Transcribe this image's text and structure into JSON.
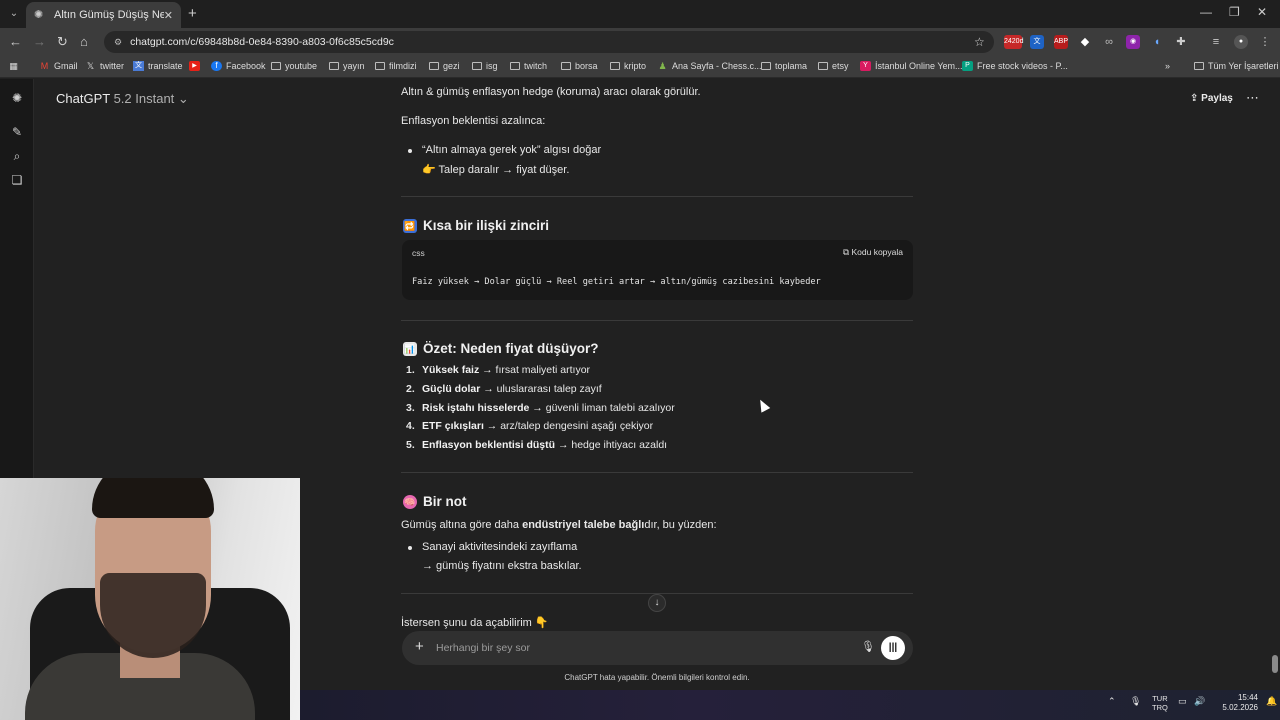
{
  "browser": {
    "tab_title": "Altın Gümüş Düşüş Nedenleri",
    "url": "chatgpt.com/c/69848b8d-0e84-8390-a803-0f6c85c5cd9c",
    "ext_badge": "2420d",
    "bookmarks": [
      "Gmail",
      "twitter",
      "translate",
      "Facebook",
      "youtube",
      "yayın",
      "filmdizi",
      "gezi",
      "isg",
      "twitch",
      "borsa",
      "kripto",
      "Ana Sayfa - Chess.c...",
      "toplama",
      "etsy",
      "İstanbul Online Yem...",
      "Free stock videos - P..."
    ],
    "all_bookmarks": "Tüm Yer İşaretleri"
  },
  "header": {
    "model_name": "ChatGPT",
    "model_version": "5.2 Instant",
    "share_label": "Paylaş"
  },
  "message": {
    "p1": "Altın & gümüş enflasyon hedge (koruma) aracı olarak görülür.",
    "p2": "Enflasyon beklentisi azalınca:",
    "bullet1_line1": "“Altın almaya gerek yok” algısı doğar",
    "bullet1_line2": "👉 Talep daralır → fiyat düşer.",
    "section1_title": "Kısa bir ilişki zinciri",
    "code_lang": "css",
    "code_copy": "Kodu kopyala",
    "code_line": "Faiz yüksek → Dolar güçlü → Reel getiri artar → altın/gümüş cazibesini kaybeder",
    "section2_title": "Özet: Neden fiyat düşüyor?",
    "summary": [
      {
        "num": "1.",
        "bold": "Yüksek faiz",
        "rest": " → fırsat maliyeti artıyor"
      },
      {
        "num": "2.",
        "bold": "Güçlü dolar",
        "rest": " → uluslararası talep zayıf"
      },
      {
        "num": "3.",
        "bold": "Risk iştahı hisselerde",
        "rest": " → güvenli liman talebi azalıyor"
      },
      {
        "num": "4.",
        "bold": "ETF çıkışları",
        "rest": " → arz/talep dengesini aşağı çekiyor"
      },
      {
        "num": "5.",
        "bold": "Enflasyon beklentisi düştü",
        "rest": " → hedge ihtiyacı azaldı"
      }
    ],
    "section3_title": "Bir not",
    "note_pre": "Gümüş altına göre daha ",
    "note_bold": "endüstriyel talebe bağlı",
    "note_post": "dır, bu yüzden:",
    "bullet2_line1": "Sanayi aktivitesindeki zayıflama",
    "bullet2_line2": "→ gümüş fiyatını ekstra baskılar.",
    "last_line": "İstersen şunu da açabilirim 👇"
  },
  "composer": {
    "placeholder": "Herhangi bir şey sor",
    "disclaimer": "ChatGPT hata yapabilir. Önemli bilgileri kontrol edin."
  },
  "taskbar": {
    "lang_top": "TUR",
    "lang_bottom": "TRQ",
    "time": "15:44",
    "date": "5.02.2026"
  }
}
